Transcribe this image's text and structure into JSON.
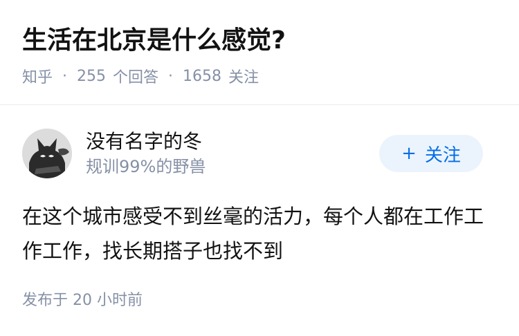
{
  "question": {
    "title": "生活在北京是什么感觉?",
    "source": "知乎",
    "separator": "·",
    "answer_count": "255",
    "answer_label": "个回答",
    "follower_count": "1658",
    "follower_label": "关注"
  },
  "answer": {
    "author": {
      "name": "没有名字的冬",
      "bio": "规训99%的野兽",
      "avatar_icon": "cat-avatar-icon"
    },
    "follow_button": {
      "plus": "+",
      "label": "关注"
    },
    "content": "在这个城市感受不到丝毫的活力，每个人都在工作工作工作，找长期搭子也找不到",
    "publish_time": "发布于 20 小时前"
  },
  "colors": {
    "accent": "#056de8",
    "follow_bg": "#ebf4fd",
    "meta_text": "#8590a6",
    "primary_text": "#121212"
  }
}
